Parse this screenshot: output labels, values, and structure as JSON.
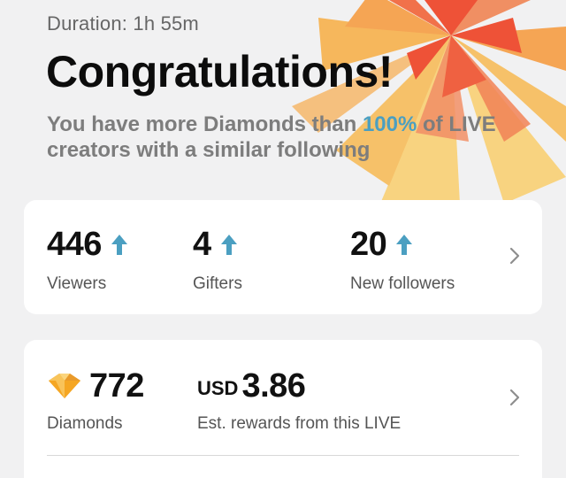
{
  "header": {
    "duration": "Duration: 1h 55m",
    "title": "Congratulations!",
    "subtitle_before": "You have more Diamonds than ",
    "subtitle_accent": "100%",
    "subtitle_after": " of LIVE creators with a similar following"
  },
  "stats": [
    {
      "value": "446",
      "label": "Viewers",
      "trend_icon": "arrow-up-icon"
    },
    {
      "value": "4",
      "label": "Gifters",
      "trend_icon": "arrow-up-icon"
    },
    {
      "value": "20",
      "label": "New followers",
      "trend_icon": "arrow-up-icon"
    }
  ],
  "rewards": {
    "diamonds_value": "772",
    "diamonds_label": "Diamonds",
    "diamond_icon": "diamond-icon",
    "currency": "USD",
    "usd_value": "3.86",
    "usd_label": "Est. rewards from this LIVE"
  },
  "colors": {
    "accent_blue": "#4b9fc1",
    "background": "#f1f1f2",
    "burst_red": "#ee4a2e",
    "burst_orange": "#f6a14c",
    "burst_yellow": "#f9d27a"
  }
}
